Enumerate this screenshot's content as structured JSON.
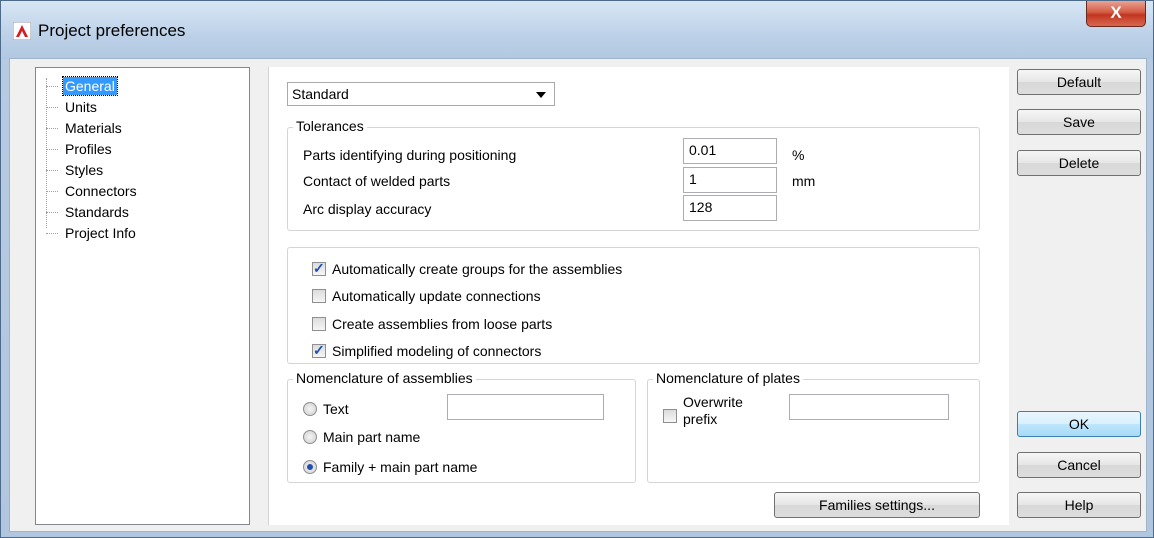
{
  "window": {
    "title": "Project preferences",
    "close_glyph": "X"
  },
  "tree": {
    "items": [
      {
        "label": "General",
        "selected": true
      },
      {
        "label": "Units"
      },
      {
        "label": "Materials"
      },
      {
        "label": "Profiles"
      },
      {
        "label": "Styles"
      },
      {
        "label": "Connectors"
      },
      {
        "label": "Standards"
      },
      {
        "label": "Project Info"
      }
    ]
  },
  "general": {
    "standard_select": "Standard",
    "tolerances": {
      "legend": "Tolerances",
      "rows": [
        {
          "label": "Parts identifying during positioning",
          "value": "0.01",
          "unit": "%"
        },
        {
          "label": "Contact of welded parts",
          "value": "1",
          "unit": "mm"
        },
        {
          "label": "Arc display accuracy",
          "value": "128",
          "unit": ""
        }
      ]
    },
    "options": [
      {
        "label": "Automatically create groups for the assemblies",
        "checked": true
      },
      {
        "label": "Automatically update connections",
        "checked": false
      },
      {
        "label": "Create assemblies from loose parts",
        "checked": false
      },
      {
        "label": "Simplified modeling of connectors",
        "checked": true
      }
    ],
    "nomenclature_assemblies": {
      "legend": "Nomenclature of assemblies",
      "options": [
        {
          "label": "Text",
          "selected": false
        },
        {
          "label": "Main part name",
          "selected": false
        },
        {
          "label": "Family + main part name",
          "selected": true
        }
      ],
      "text_value": ""
    },
    "nomenclature_plates": {
      "legend": "Nomenclature of plates",
      "overwrite_label_1": "Overwrite",
      "overwrite_label_2": "prefix",
      "overwrite_checked": false,
      "prefix_value": ""
    },
    "families_button": "Families settings..."
  },
  "buttons": {
    "default": "Default",
    "save": "Save",
    "delete": "Delete",
    "ok": "OK",
    "cancel": "Cancel",
    "help": "Help"
  },
  "colors": {
    "selection": "#3399ff",
    "accent": "#1c4fb4",
    "close": "#c2351f"
  }
}
